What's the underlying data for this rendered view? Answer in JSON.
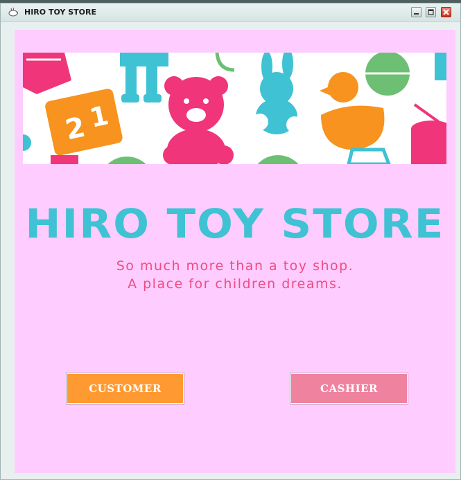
{
  "window": {
    "title": "HIRO TOY STORE",
    "icons": [
      "app-icon",
      "minimize-icon",
      "maximize-icon",
      "close-icon"
    ]
  },
  "banner": {
    "description_icons": [
      "drum-icon",
      "robot-icon",
      "teddy-bear-icon",
      "bunny-icon",
      "duck-icon",
      "ball-icon",
      "alphabet-block-icon",
      "car-icon"
    ],
    "colors": {
      "pink": "#f0357a",
      "cyan": "#3fc2d3",
      "orange": "#f7931e",
      "green": "#6cbf73",
      "white": "#ffffff"
    }
  },
  "main": {
    "heading": "HIRO TOY STORE",
    "tagline_line1": "So much more than a toy shop.",
    "tagline_line2": "A place for children dreams."
  },
  "buttons": {
    "customer": "CUSTOMER",
    "cashier": "CASHIER"
  },
  "colors": {
    "background": "#ffccff",
    "heading": "#3fc2d3",
    "tagline": "#ee4d82",
    "customer_button": "#ff9a33",
    "cashier_button": "#ef839f"
  }
}
